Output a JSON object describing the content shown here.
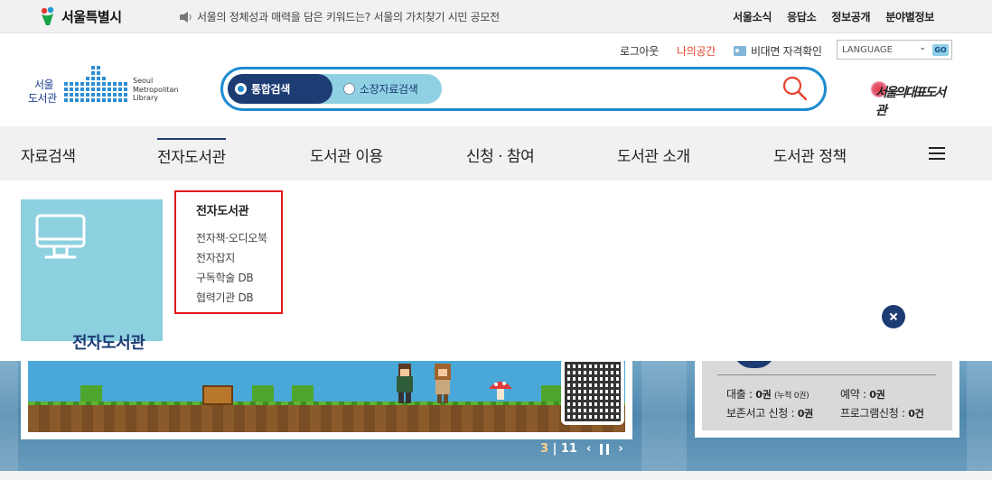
{
  "topbar": {
    "city_name": "서울특별시",
    "notice": "서울의 정체성과 매력을 담은 키워드는? 서울의 가치찾기 시민 공모전",
    "links": [
      "서울소식",
      "응답소",
      "정보공개",
      "분야별정보"
    ]
  },
  "header": {
    "logout": "로그아웃",
    "my_space": "나의공간",
    "verify": "비대면 자격확인",
    "language": "LANGUAGE",
    "go": "GO",
    "logo_ko_line1": "서울",
    "logo_ko_line2": "도서관",
    "logo_en": [
      "Seoul",
      "Metropolitan",
      "Library"
    ],
    "right_logo": "서울의대표도서관"
  },
  "search": {
    "tab_all": "통합검색",
    "tab_collection": "소장자료검색",
    "placeholder": ""
  },
  "gnb": {
    "items": [
      "자료검색",
      "전자도서관",
      "도서관 이용",
      "신청 · 참여",
      "도서관 소개",
      "도서관 정책"
    ]
  },
  "dropdown": {
    "tile_title": "전자도서관",
    "head": "전자도서관",
    "links": [
      "전자책·오디오북",
      "전자잡지",
      "구독학술 DB",
      "협력기관 DB"
    ]
  },
  "banner": {
    "page_current": "3",
    "page_total": "11"
  },
  "account": {
    "loan_label": "대출 : ",
    "loan_value": "0권",
    "loan_overdue": "(누적 0권)",
    "reserve_label": "예약 : ",
    "reserve_value": "0권",
    "storage_label": "보존서고 신청 : ",
    "storage_value": "0권",
    "program_label": "프로그램신청 : ",
    "program_value": "0건"
  },
  "colors": {
    "brand_navy": "#1d3c74",
    "search_border": "#1e8bd1",
    "tile_cyan": "#8dd0e0",
    "highlight_red": "#e11b1b",
    "my_space_red": "#e8402d"
  }
}
